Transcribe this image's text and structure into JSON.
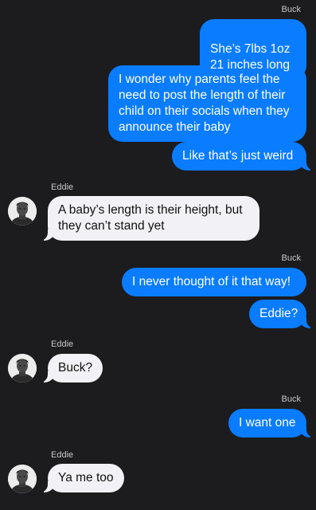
{
  "thread": {
    "messages": [
      {
        "sender": "Buck",
        "text": "She’s 7lbs 1oz\n21 inches long"
      },
      {
        "text": "I wonder why parents feel the need to post the length of their child on their socials when they announce their baby"
      },
      {
        "text": "Like that’s just weird"
      },
      {
        "sender": "Eddie",
        "text": "A baby’s length is their height, but they can’t stand yet"
      },
      {
        "sender": "Buck",
        "text": "I never thought of it that way!"
      },
      {
        "text": "Eddie?"
      },
      {
        "sender": "Eddie",
        "text": "Buck?"
      },
      {
        "sender": "Buck",
        "text": "I want one"
      },
      {
        "sender": "Eddie",
        "text": "Ya me too"
      }
    ]
  },
  "colors": {
    "background": "#1c1c1e",
    "outgoing_bubble": "#0a7cff",
    "incoming_bubble": "#f2f2f6"
  },
  "icons": {
    "contact_avatar": "person-photo-avatar-icon"
  }
}
